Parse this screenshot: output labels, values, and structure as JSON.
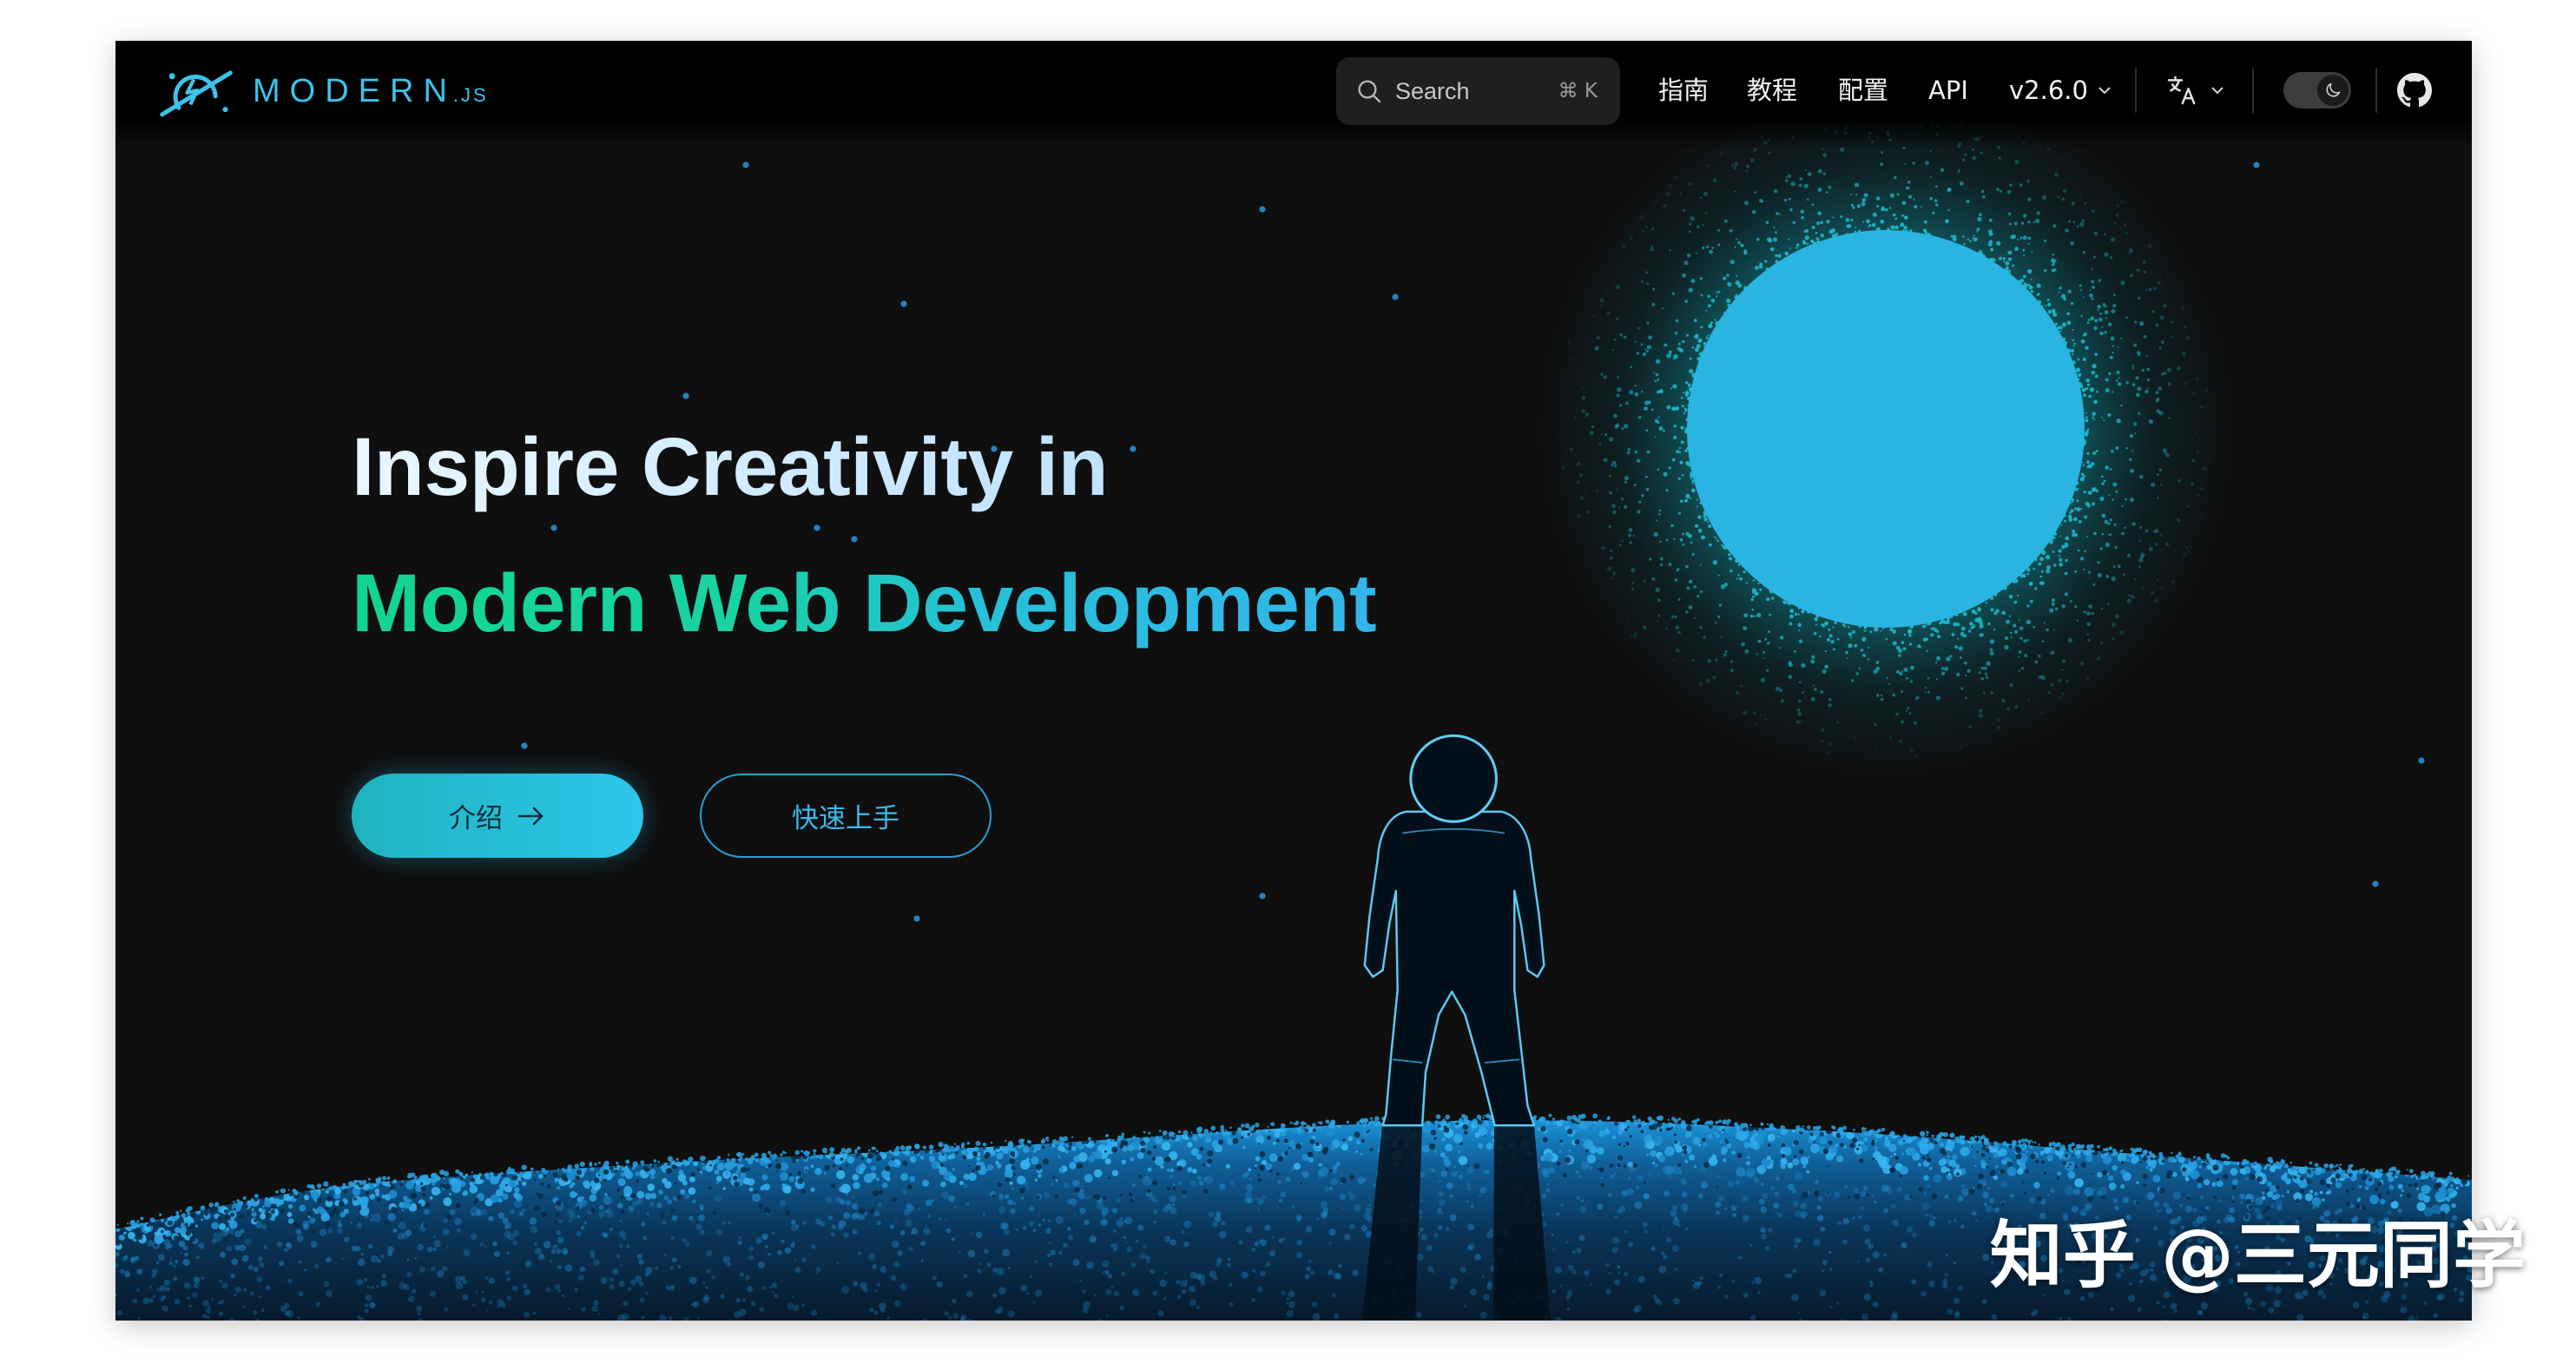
{
  "app": {
    "logo_text": "MODERN",
    "logo_suffix": ".JS"
  },
  "header": {
    "search": {
      "placeholder": "Search",
      "shortcut": "⌘ K"
    },
    "nav_items": [
      {
        "label": "指南"
      },
      {
        "label": "教程"
      },
      {
        "label": "配置"
      },
      {
        "label": "API"
      }
    ],
    "version": "v2.6.0",
    "icons": {
      "logo": "modern-js-logo-icon",
      "search": "search-icon",
      "version_menu": "chevron-down-icon",
      "language": "translate-icon",
      "theme": "moon-icon",
      "repo": "github-icon"
    }
  },
  "hero": {
    "title_line1": "Inspire Creativity in",
    "title_line2": "Modern Web Development",
    "primary_button": {
      "label": "介绍",
      "icon": "arrow-right-icon"
    },
    "secondary_button": {
      "label": "快速上手"
    }
  },
  "watermark": "知乎 @三元同学",
  "colors": {
    "background": "#0f0f10",
    "accent_cyan": "#2ab4e1",
    "accent_green": "#12d48f",
    "ground_blue": "#1f98dc",
    "title_light": "#d8efff"
  },
  "theme": {
    "dark_mode": true
  }
}
